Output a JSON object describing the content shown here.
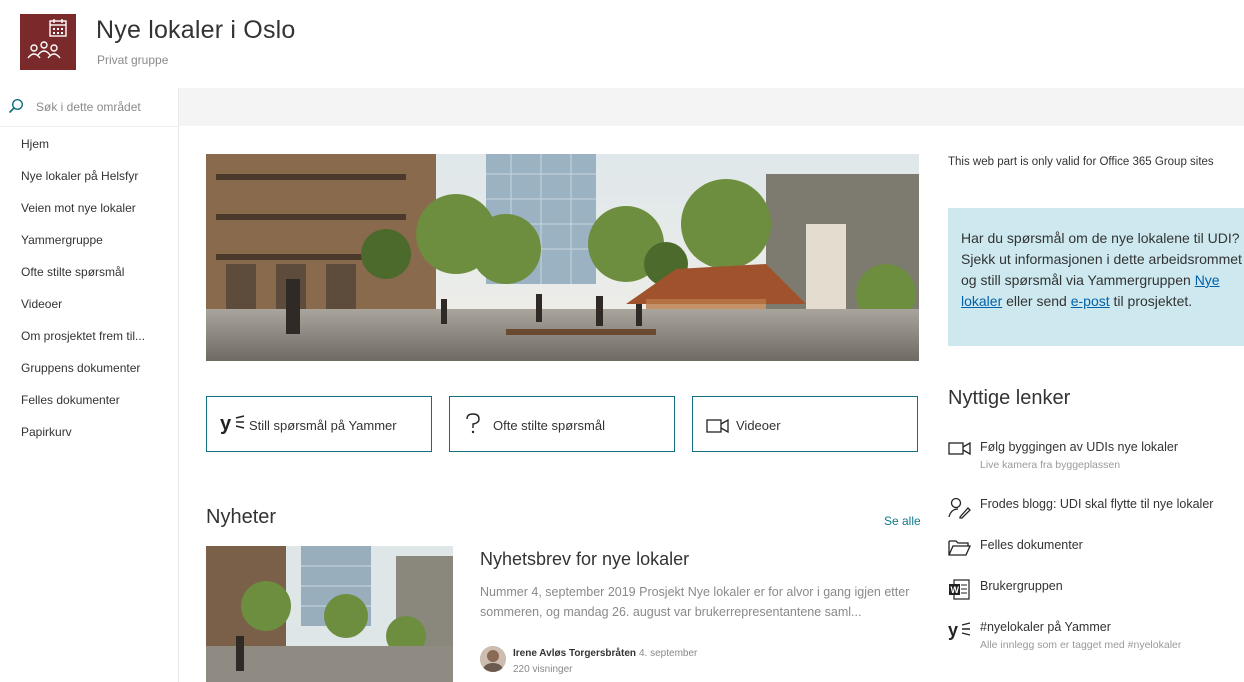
{
  "header": {
    "title": "Nye lokaler i Oslo",
    "subtitle": "Privat gruppe",
    "logo_color": "#7a2a2a"
  },
  "search": {
    "placeholder": "Søk i dette området",
    "icon": "search-icon"
  },
  "nav": {
    "items": [
      {
        "label": "Hjem"
      },
      {
        "label": "Nye lokaler på Helsfyr"
      },
      {
        "label": "Veien mot nye lokaler"
      },
      {
        "label": "Yammergruppe"
      },
      {
        "label": "Ofte stilte spørsmål"
      },
      {
        "label": "Videoer"
      },
      {
        "label": "Om prosjektet frem til..."
      },
      {
        "label": "Gruppens dokumenter"
      },
      {
        "label": "Felles dokumenter"
      },
      {
        "label": "Papirkurv"
      }
    ]
  },
  "quick_links": [
    {
      "label": "Still spørsmål på Yammer",
      "icon": "yammer-icon"
    },
    {
      "label": "Ofte stilte spørsmål",
      "icon": "question-icon"
    },
    {
      "label": "Videoer",
      "icon": "video-icon"
    }
  ],
  "news": {
    "heading": "Nyheter",
    "see_all": "Se alle",
    "item": {
      "title": "Nyhetsbrev for nye lokaler",
      "description": "Nummer 4, september 2019 Prosjekt Nye lokaler er for alvor i gang igjen etter sommeren, og mandag 26. august var brukerrepresentantene saml...",
      "author": "Irene Avløs Torgersbråten",
      "date": "4. september",
      "views": "220 visninger"
    }
  },
  "right": {
    "valid_note": "This web part is only valid for Office 365 Group sites",
    "callout": {
      "text_before": "Har du spørsmål om de nye lokalene til UDI? Sjekk ut informasjonen i dette arbeidsrommet og still spørsmål via Yammergruppen ",
      "link1": "Nye lokaler",
      "text_middle": " eller send ",
      "link2": "e-post",
      "text_after": " til prosjektet.",
      "bg_color": "#cde9ef"
    },
    "useful_heading": "Nyttige lenker",
    "links": [
      {
        "title": "Følg byggingen av UDIs nye lokaler",
        "sub": "Live kamera fra byggeplassen",
        "icon": "video-icon"
      },
      {
        "title": "Frodes blogg: UDI skal flytte til nye lokaler",
        "sub": "",
        "icon": "person-edit-icon"
      },
      {
        "title": "Felles dokumenter",
        "sub": "",
        "icon": "folder-icon"
      },
      {
        "title": "Brukergruppen",
        "sub": "",
        "icon": "word-document-icon"
      },
      {
        "title": "#nyelokaler på Yammer",
        "sub": "Alle innlegg som er tagget med #nyelokaler",
        "icon": "yammer-icon"
      }
    ]
  },
  "colors": {
    "accent": "#0f6f7f",
    "link": "#0060a8",
    "cmdbar": "#f4f4f4"
  }
}
